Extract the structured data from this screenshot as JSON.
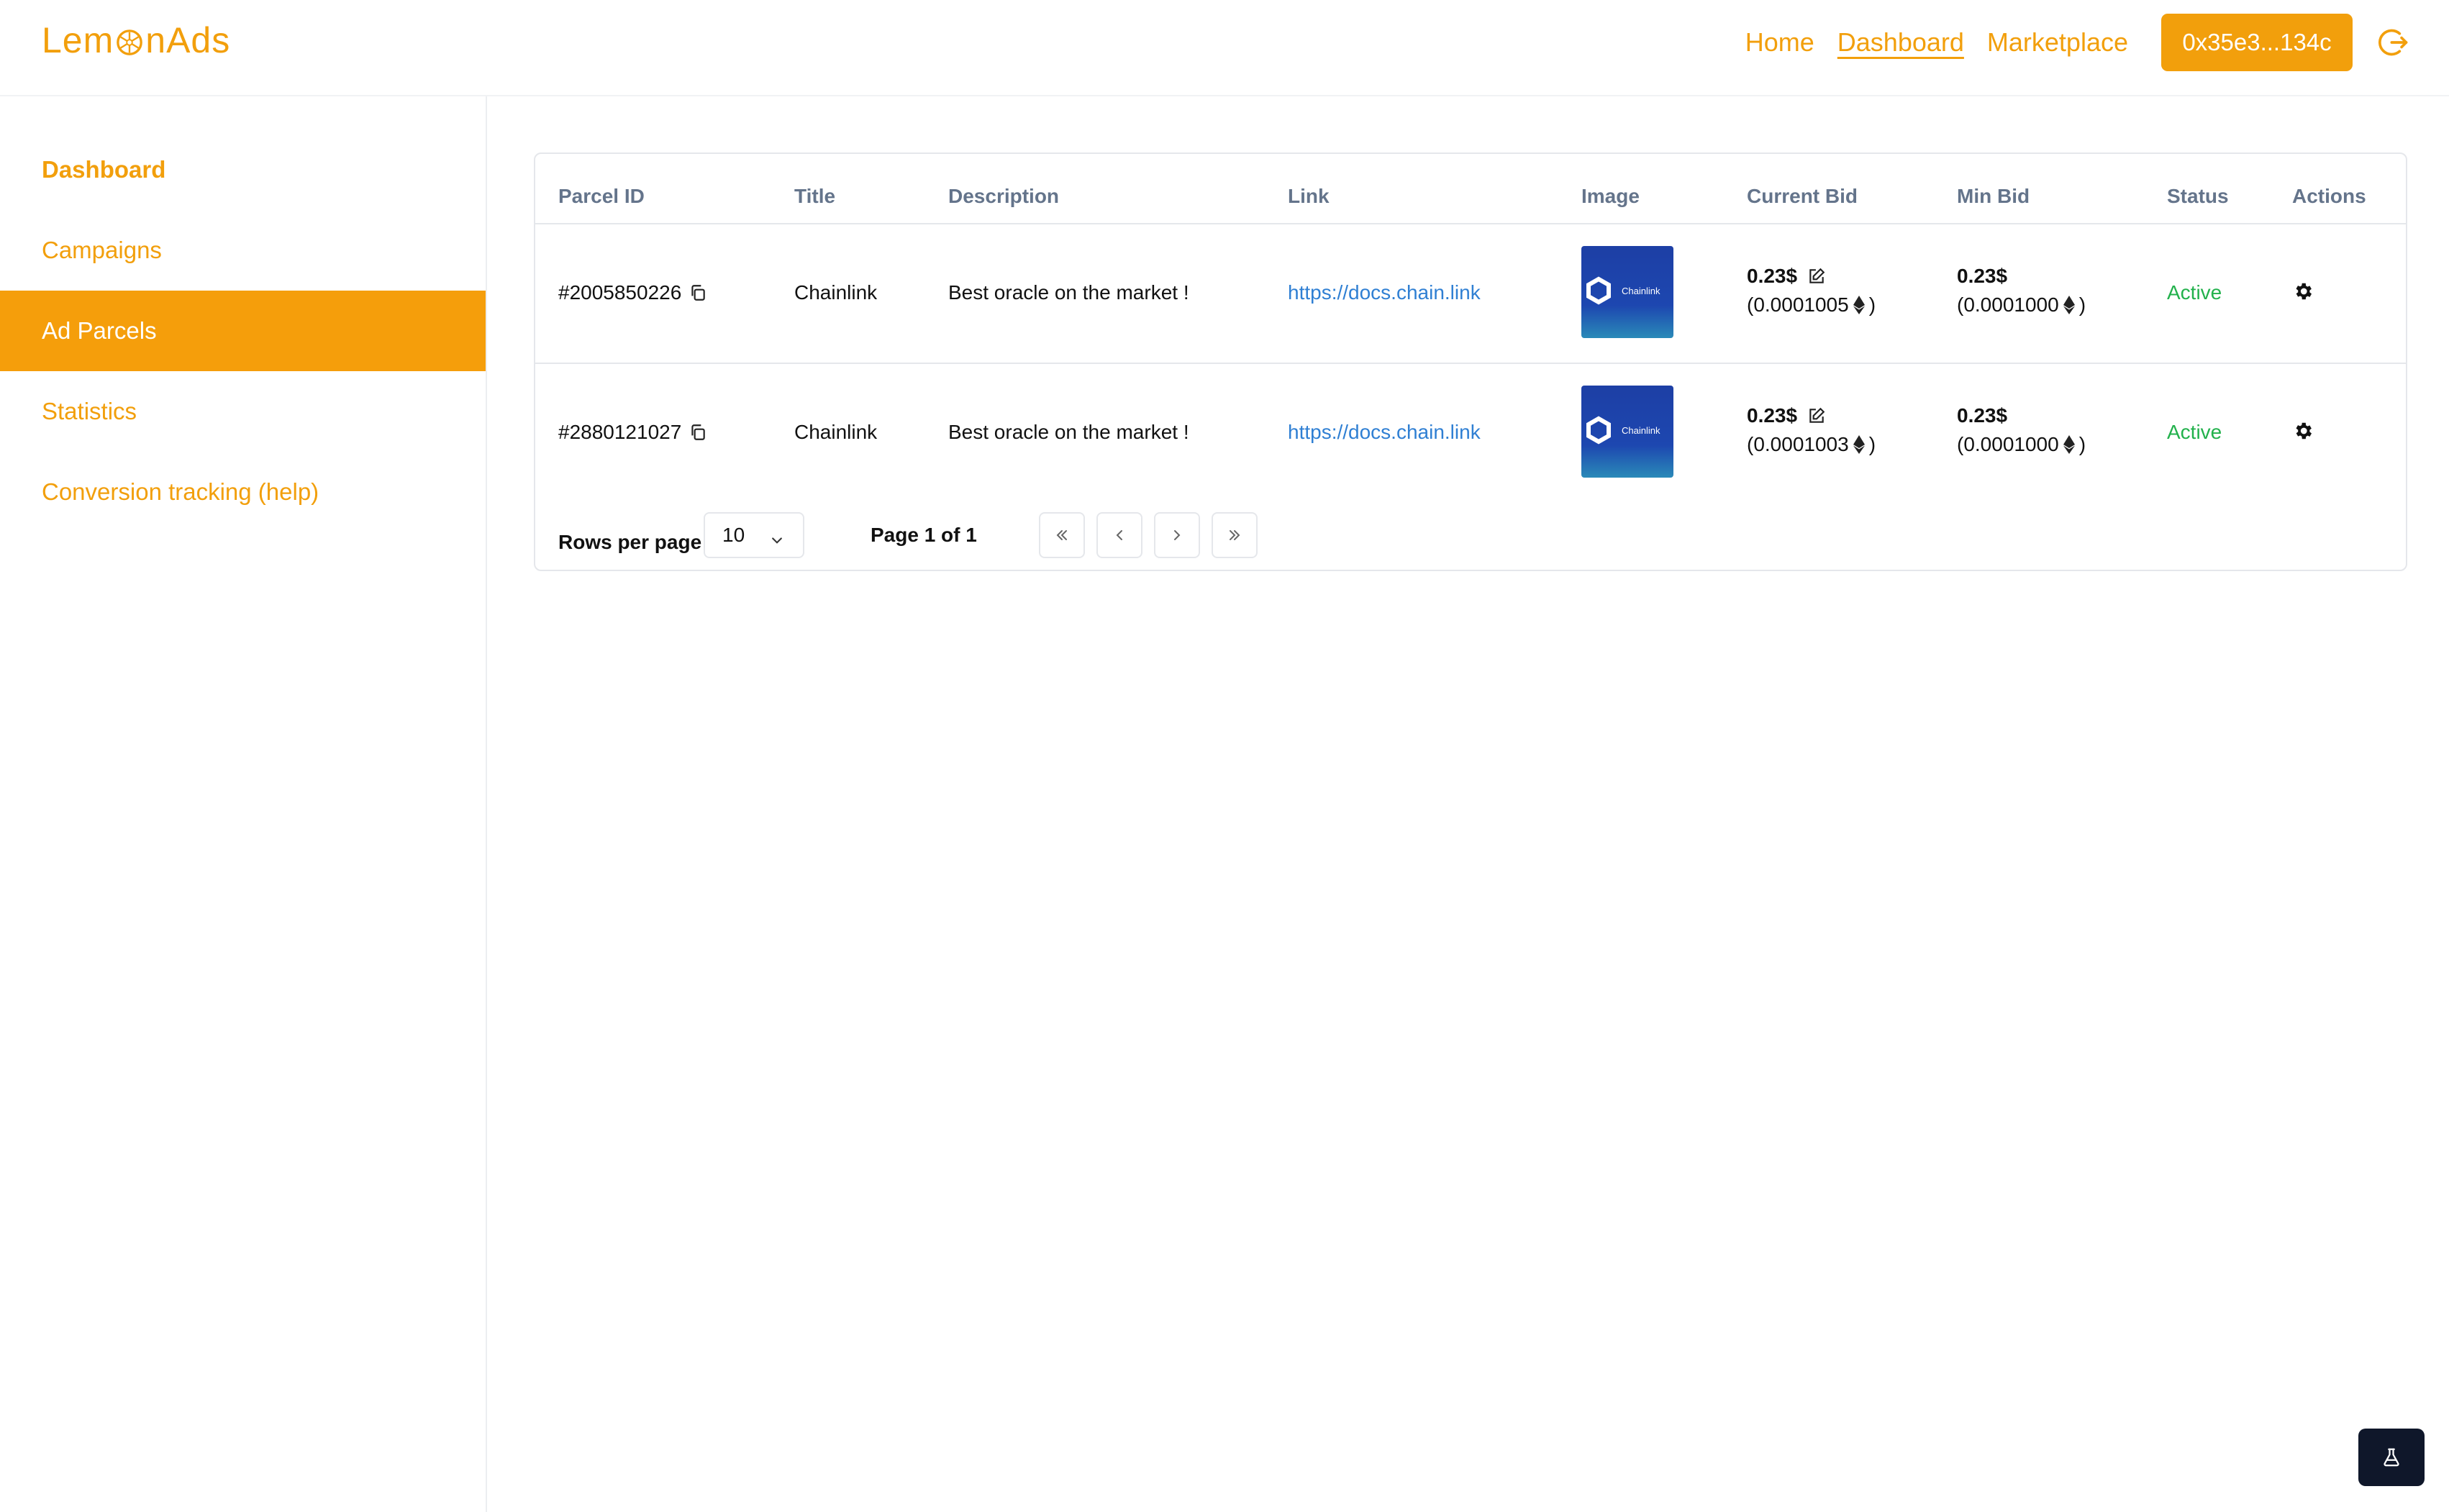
{
  "header": {
    "logo_part1": "Lem",
    "logo_part2": "nAds",
    "nav": [
      {
        "label": "Home"
      },
      {
        "label": "Dashboard"
      },
      {
        "label": "Marketplace"
      }
    ],
    "wallet_label": "0x35e3...134c"
  },
  "sidebar": {
    "items": [
      {
        "label": "Dashboard"
      },
      {
        "label": "Campaigns"
      },
      {
        "label": "Ad Parcels"
      },
      {
        "label": "Statistics"
      },
      {
        "label": "Conversion tracking (help)"
      }
    ]
  },
  "table": {
    "headers": [
      "Parcel ID",
      "Title",
      "Description",
      "Link",
      "Image",
      "Current Bid",
      "Min Bid",
      "Status",
      "Actions"
    ],
    "rows": [
      {
        "parcel_id": "#2005850226",
        "title": "Chainlink",
        "description": "Best oracle on the market !",
        "link": "https://docs.chain.link",
        "image_text": "Chainlink",
        "current_bid_usd": "0.23$",
        "current_bid_eth": "(0.0001005",
        "min_bid_usd": "0.23$",
        "min_bid_eth": "(0.0001000",
        "status": "Active"
      },
      {
        "parcel_id": "#2880121027",
        "title": "Chainlink",
        "description": "Best oracle on the market !",
        "link": "https://docs.chain.link",
        "image_text": "Chainlink",
        "current_bid_usd": "0.23$",
        "current_bid_eth": "(0.0001003",
        "min_bid_usd": "0.23$",
        "min_bid_eth": "(0.0001000",
        "status": "Active"
      }
    ],
    "close_paren": ")"
  },
  "pagination": {
    "rows_per_page_label": "Rows per page",
    "rows_per_page_value": "10",
    "page_label": "Page 1 of 1"
  },
  "colors": {
    "brand": "#f29f0c",
    "link": "#2f7fd3",
    "status_active": "#22b14c",
    "header_text": "#64748b"
  }
}
